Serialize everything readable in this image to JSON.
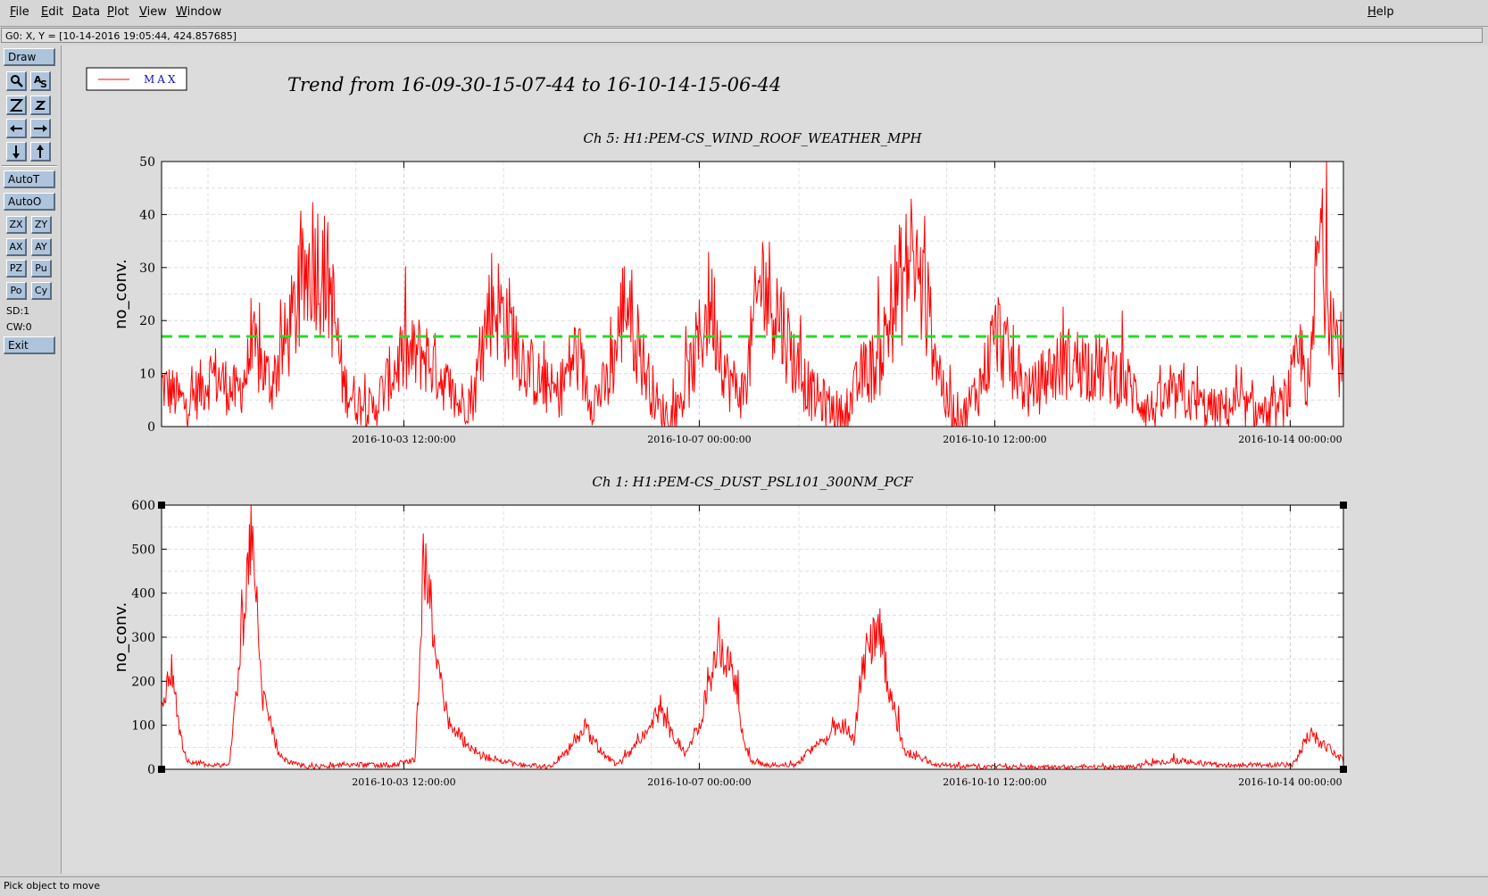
{
  "menubar": {
    "items": [
      "File",
      "Edit",
      "Data",
      "Plot",
      "View",
      "Window"
    ],
    "help": "Help"
  },
  "coord_readout": "G0: X, Y = [10-14-2016 19:05:44, 424.857685]",
  "toolbar": {
    "draw": "Draw",
    "autot": "AutoT",
    "autoo": "AutoO",
    "small_buttons": [
      "ZX",
      "ZY",
      "AX",
      "AY",
      "PZ",
      "Pu",
      "Po",
      "Cy"
    ],
    "sd": "SD:1",
    "cw": "CW:0",
    "exit": "Exit",
    "icons": [
      "zoom-icon",
      "text-icon",
      "zoom-in-icon",
      "zoom-out-icon",
      "arrow-left-icon",
      "arrow-right-icon",
      "arrow-down-icon",
      "arrow-up-icon"
    ]
  },
  "legend": {
    "label": "MAX",
    "color": "#ff0000"
  },
  "title": "Trend from 16-09-30-15-07-44 to 16-10-14-15-06-44",
  "status": "Pick object to move",
  "colors": {
    "trace": "#ff0000",
    "threshold": "#22dd22",
    "text_legend": "#1010cc"
  },
  "chart_data": [
    {
      "type": "line",
      "title": "Ch 5: H1:PEM-CS_WIND_ROOF_WEATHER_MPH",
      "ylabel": "no_conv.",
      "xlim": [
        "2016-09-30 15:07:44",
        "2016-10-14 15:06:44"
      ],
      "ylim": [
        0,
        50
      ],
      "yticks": [
        0,
        10,
        20,
        30,
        40,
        50
      ],
      "xtick_labels": [
        "2016-10-03 12:00:00",
        "2016-10-07 00:00:00",
        "2016-10-10 12:00:00",
        "2016-10-14 00:00:00"
      ],
      "grid": true,
      "threshold": 17,
      "series": [
        {
          "name": "MAX",
          "x_unit": "day",
          "x": [
            0.0,
            0.3,
            0.6,
            0.9,
            1.1,
            1.3,
            1.6,
            1.8,
            2.0,
            2.15,
            2.3,
            2.5,
            2.8,
            3.1,
            3.3,
            3.5,
            3.7,
            3.9,
            4.1,
            4.3,
            4.5,
            4.7,
            4.9,
            5.1,
            5.3,
            5.5,
            5.7,
            5.9,
            6.1,
            6.3,
            6.5,
            6.7,
            6.9,
            7.1,
            7.3,
            7.5,
            7.7,
            7.9,
            8.1,
            8.3,
            8.5,
            8.7,
            8.9,
            9.1,
            9.3,
            9.5,
            9.7,
            9.9,
            10.1,
            10.3,
            10.5,
            10.7,
            10.9,
            11.1,
            11.3,
            11.5,
            11.7,
            11.9,
            12.1,
            12.3,
            12.5,
            12.7,
            12.9,
            13.1,
            13.3,
            13.5,
            13.6,
            13.7,
            13.8,
            14.0
          ],
          "y": [
            8,
            4,
            10,
            6,
            14,
            8,
            22,
            33,
            26,
            8,
            5,
            3,
            12,
            14,
            10,
            4,
            6,
            24,
            20,
            12,
            8,
            6,
            14,
            5,
            8,
            25,
            12,
            3,
            2,
            12,
            24,
            9,
            6,
            28,
            22,
            12,
            6,
            4,
            2,
            10,
            12,
            25,
            32,
            20,
            4,
            2,
            8,
            18,
            10,
            6,
            10,
            12,
            12,
            11,
            10,
            7,
            3,
            5,
            6,
            4,
            3,
            4,
            3,
            2,
            4,
            14,
            6,
            35,
            28,
            8
          ]
        }
      ]
    },
    {
      "type": "line",
      "title": "Ch 1: H1:PEM-CS_DUST_PSL101_300NM_PCF",
      "ylabel": "no_conv.",
      "xlim": [
        "2016-09-30 15:07:44",
        "2016-10-14 15:06:44"
      ],
      "ylim": [
        0,
        600
      ],
      "yticks": [
        0,
        100,
        200,
        300,
        400,
        500,
        600
      ],
      "xtick_labels": [
        "2016-10-03 12:00:00",
        "2016-10-07 00:00:00",
        "2016-10-10 12:00:00",
        "2016-10-14 00:00:00"
      ],
      "grid": true,
      "series": [
        {
          "name": "MAX",
          "x_unit": "day",
          "x": [
            0.0,
            0.1,
            0.15,
            0.2,
            0.3,
            0.4,
            0.6,
            0.8,
            1.0,
            1.05,
            1.08,
            1.1,
            1.2,
            1.4,
            1.6,
            1.8,
            2.0,
            2.2,
            2.4,
            2.6,
            2.8,
            3.0,
            3.05,
            3.1,
            3.15,
            3.2,
            3.4,
            3.6,
            3.8,
            4.0,
            4.3,
            4.6,
            4.9,
            5.0,
            5.2,
            5.4,
            5.7,
            5.9,
            6.0,
            6.2,
            6.4,
            6.6,
            6.8,
            6.9,
            7.0,
            7.2,
            7.5,
            7.8,
            8.1,
            8.2,
            8.3,
            8.5,
            8.6,
            8.8,
            9.2,
            9.6,
            10.0,
            10.5,
            11.0,
            11.5,
            12.0,
            12.5,
            13.0,
            13.4,
            13.6,
            13.8,
            14.0
          ],
          "y": [
            130,
            240,
            200,
            100,
            20,
            15,
            10,
            10,
            380,
            520,
            560,
            430,
            160,
            30,
            10,
            5,
            8,
            10,
            10,
            10,
            10,
            20,
            200,
            470,
            440,
            300,
            110,
            60,
            30,
            20,
            10,
            5,
            60,
            100,
            40,
            10,
            70,
            140,
            90,
            40,
            120,
            290,
            200,
            60,
            15,
            10,
            10,
            60,
            100,
            60,
            230,
            340,
            200,
            40,
            10,
            5,
            5,
            5,
            5,
            5,
            20,
            10,
            10,
            10,
            80,
            50,
            20
          ]
        }
      ]
    }
  ]
}
